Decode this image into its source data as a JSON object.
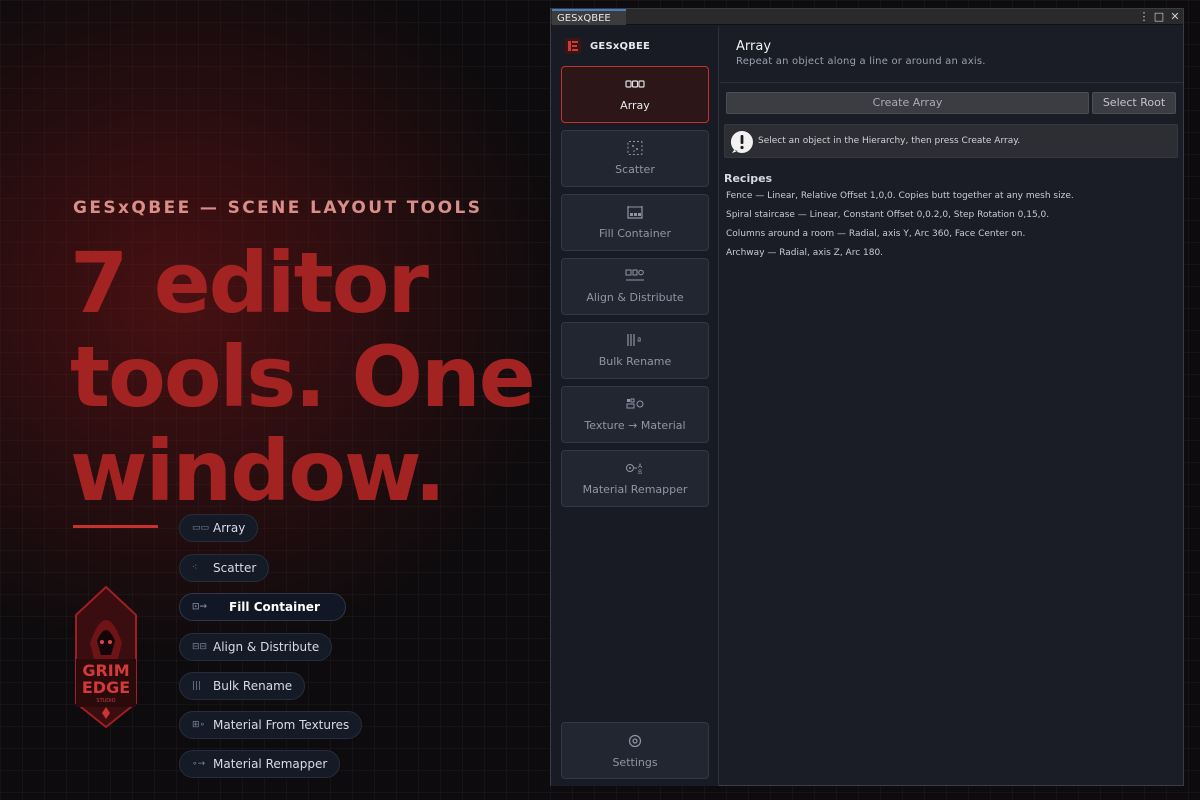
{
  "marketing": {
    "kicker": "GESxQBEE — SCENE LAYOUT TOOLS",
    "headline_lines": [
      "7 editor",
      "tools. One",
      "window."
    ],
    "pills": [
      {
        "label": "Array",
        "icon": "array-icon"
      },
      {
        "label": "Scatter",
        "icon": "scatter-icon"
      },
      {
        "label": "Fill Container",
        "icon": "fill-container-icon",
        "active": true
      },
      {
        "label": "Align & Distribute",
        "icon": "align-icon"
      },
      {
        "label": "Bulk Rename",
        "icon": "rename-icon"
      },
      {
        "label": "Material From Textures",
        "icon": "texture-icon"
      },
      {
        "label": "Material Remapper",
        "icon": "remap-icon"
      }
    ],
    "logo": {
      "line1": "GRIM",
      "line2": "EDGE",
      "line3": "STUDIO"
    },
    "accent_color": "#a32323"
  },
  "window": {
    "tab_title": "GESxQBEE",
    "controls": {
      "menu": "⋮",
      "maximize": "□",
      "close": "✕"
    }
  },
  "sidebar": {
    "brand": "GESxQBEE",
    "items": [
      {
        "label": "Array",
        "icon": "array-icon",
        "active": true
      },
      {
        "label": "Scatter",
        "icon": "scatter-icon"
      },
      {
        "label": "Fill Container",
        "icon": "fill-container-icon"
      },
      {
        "label": "Align & Distribute",
        "icon": "align-icon"
      },
      {
        "label": "Bulk Rename",
        "icon": "rename-icon"
      },
      {
        "label": "Texture → Material",
        "icon": "texture-icon"
      },
      {
        "label": "Material Remapper",
        "icon": "remap-icon"
      }
    ],
    "settings_label": "Settings"
  },
  "main": {
    "title": "Array",
    "subtitle": "Repeat an object along a line or around an axis.",
    "create_button": "Create Array",
    "select_root_button": "Select Root",
    "help_text": "Select an object in the Hierarchy, then press Create Array.",
    "recipes_title": "Recipes",
    "recipes": [
      "Fence — Linear, Relative Offset 1,0,0. Copies butt together at any mesh size.",
      "Spiral staircase — Linear, Constant Offset 0,0.2,0, Step Rotation 0,15,0.",
      "Columns around a room — Radial, axis Y, Arc 360, Face Center on.",
      "Archway — Radial, axis Z, Arc 180."
    ]
  }
}
